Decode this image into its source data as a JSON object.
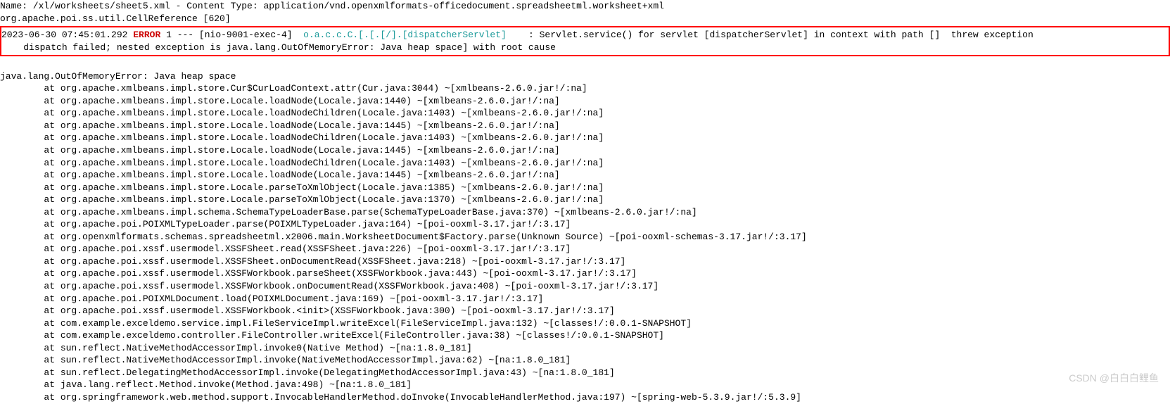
{
  "top_lines": [
    "Name: /xl/worksheets/sheet5.xml - Content Type: application/vnd.openxmlformats-officedocument.spreadsheetml.worksheet+xml",
    "org.apache.poi.ss.util.CellReference [620]"
  ],
  "error_line": {
    "timestamp": "2023-06-30 07:45:01.292",
    "level": "ERROR",
    "thread_num": "1",
    "separator": "---",
    "thread": "[nio-9001-exec-4]",
    "logger": "o.a.c.c.C.[.[.[/].[dispatcherServlet]",
    "message": ": Servlet.service() for servlet [dispatcherServlet] in context with path []  threw exception",
    "continuation": "dispatch failed; nested exception is java.lang.OutOfMemoryError: Java heap space] with root cause"
  },
  "exception_header": "java.lang.OutOfMemoryError: Java heap space",
  "stack_trace": [
    "        at org.apache.xmlbeans.impl.store.Cur$CurLoadContext.attr(Cur.java:3044) ~[xmlbeans-2.6.0.jar!/:na]",
    "        at org.apache.xmlbeans.impl.store.Locale.loadNode(Locale.java:1440) ~[xmlbeans-2.6.0.jar!/:na]",
    "        at org.apache.xmlbeans.impl.store.Locale.loadNodeChildren(Locale.java:1403) ~[xmlbeans-2.6.0.jar!/:na]",
    "        at org.apache.xmlbeans.impl.store.Locale.loadNode(Locale.java:1445) ~[xmlbeans-2.6.0.jar!/:na]",
    "        at org.apache.xmlbeans.impl.store.Locale.loadNodeChildren(Locale.java:1403) ~[xmlbeans-2.6.0.jar!/:na]",
    "        at org.apache.xmlbeans.impl.store.Locale.loadNode(Locale.java:1445) ~[xmlbeans-2.6.0.jar!/:na]",
    "        at org.apache.xmlbeans.impl.store.Locale.loadNodeChildren(Locale.java:1403) ~[xmlbeans-2.6.0.jar!/:na]",
    "        at org.apache.xmlbeans.impl.store.Locale.loadNode(Locale.java:1445) ~[xmlbeans-2.6.0.jar!/:na]",
    "        at org.apache.xmlbeans.impl.store.Locale.parseToXmlObject(Locale.java:1385) ~[xmlbeans-2.6.0.jar!/:na]",
    "        at org.apache.xmlbeans.impl.store.Locale.parseToXmlObject(Locale.java:1370) ~[xmlbeans-2.6.0.jar!/:na]",
    "        at org.apache.xmlbeans.impl.schema.SchemaTypeLoaderBase.parse(SchemaTypeLoaderBase.java:370) ~[xmlbeans-2.6.0.jar!/:na]",
    "        at org.apache.poi.POIXMLTypeLoader.parse(POIXMLTypeLoader.java:164) ~[poi-ooxml-3.17.jar!/:3.17]",
    "        at org.openxmlformats.schemas.spreadsheetml.x2006.main.WorksheetDocument$Factory.parse(Unknown Source) ~[poi-ooxml-schemas-3.17.jar!/:3.17]",
    "        at org.apache.poi.xssf.usermodel.XSSFSheet.read(XSSFSheet.java:226) ~[poi-ooxml-3.17.jar!/:3.17]",
    "        at org.apache.poi.xssf.usermodel.XSSFSheet.onDocumentRead(XSSFSheet.java:218) ~[poi-ooxml-3.17.jar!/:3.17]",
    "        at org.apache.poi.xssf.usermodel.XSSFWorkbook.parseSheet(XSSFWorkbook.java:443) ~[poi-ooxml-3.17.jar!/:3.17]",
    "        at org.apache.poi.xssf.usermodel.XSSFWorkbook.onDocumentRead(XSSFWorkbook.java:408) ~[poi-ooxml-3.17.jar!/:3.17]",
    "        at org.apache.poi.POIXMLDocument.load(POIXMLDocument.java:169) ~[poi-ooxml-3.17.jar!/:3.17]",
    "        at org.apache.poi.xssf.usermodel.XSSFWorkbook.<init>(XSSFWorkbook.java:300) ~[poi-ooxml-3.17.jar!/:3.17]",
    "        at com.example.exceldemo.service.impl.FileServiceImpl.writeExcel(FileServiceImpl.java:132) ~[classes!/:0.0.1-SNAPSHOT]",
    "        at com.example.exceldemo.controller.FileController.writeExcel(FileController.java:38) ~[classes!/:0.0.1-SNAPSHOT]",
    "        at sun.reflect.NativeMethodAccessorImpl.invoke0(Native Method) ~[na:1.8.0_181]",
    "        at sun.reflect.NativeMethodAccessorImpl.invoke(NativeMethodAccessorImpl.java:62) ~[na:1.8.0_181]",
    "        at sun.reflect.DelegatingMethodAccessorImpl.invoke(DelegatingMethodAccessorImpl.java:43) ~[na:1.8.0_181]",
    "        at java.lang.reflect.Method.invoke(Method.java:498) ~[na:1.8.0_181]",
    "        at org.springframework.web.method.support.InvocableHandlerMethod.doInvoke(InvocableHandlerMethod.java:197) ~[spring-web-5.3.9.jar!/:5.3.9]"
  ],
  "watermark": "CSDN @白白白鲤鱼"
}
